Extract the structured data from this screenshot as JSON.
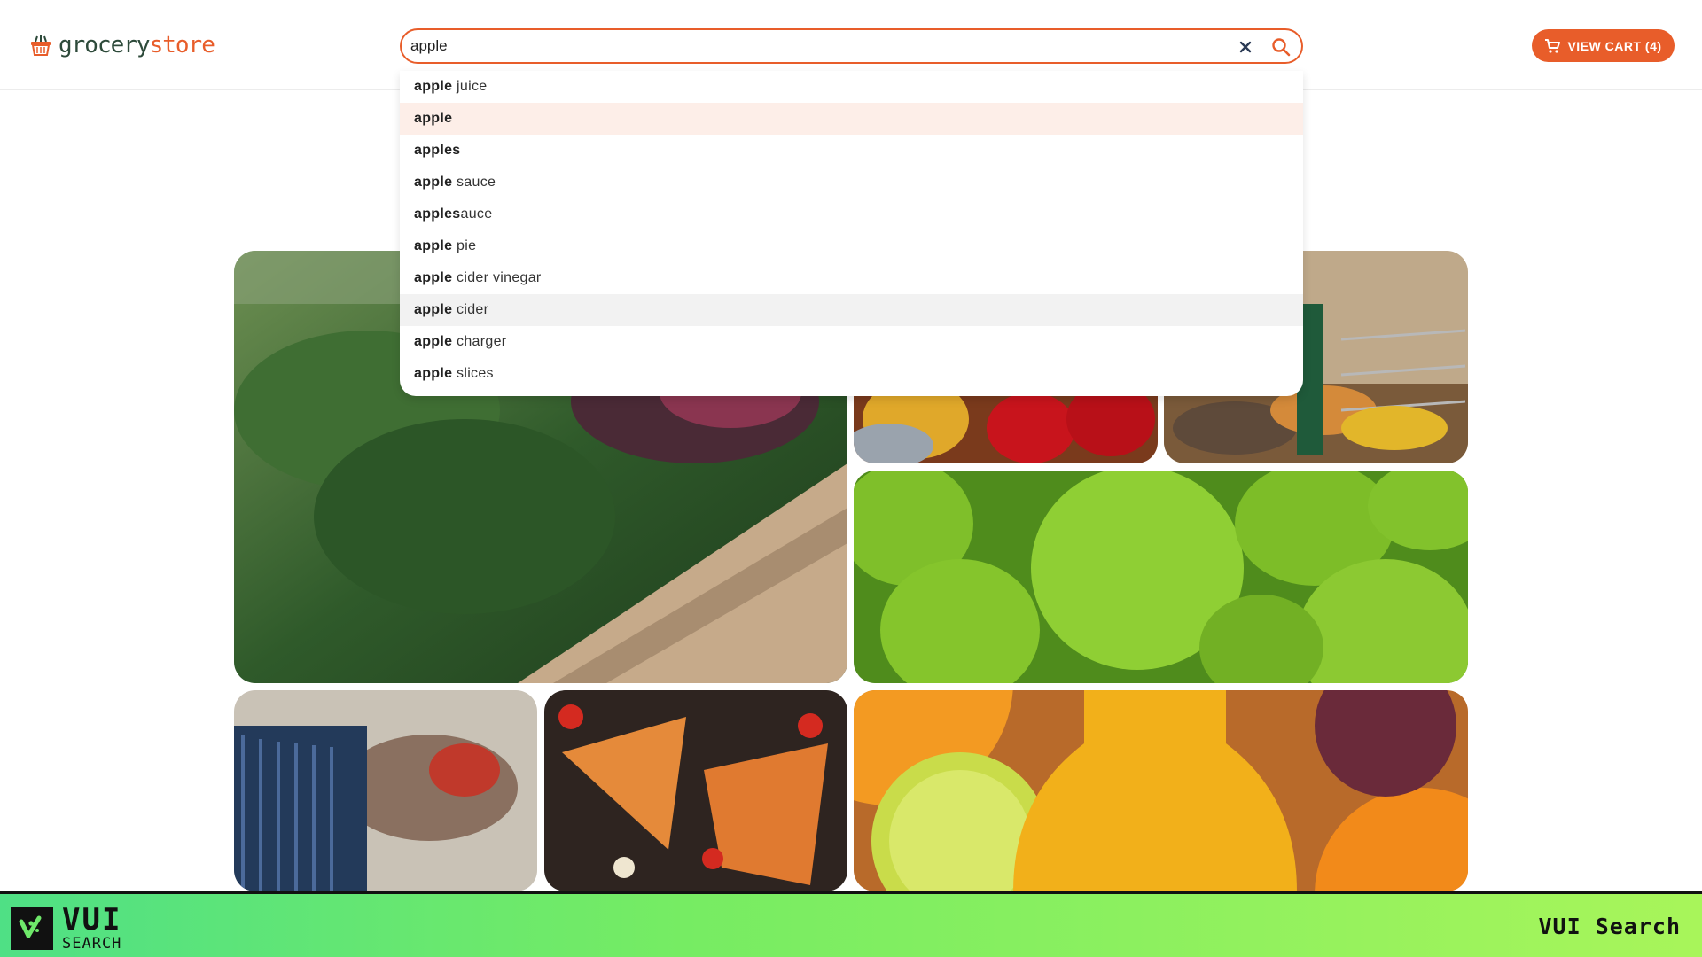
{
  "header": {
    "logo_part1": "grocery",
    "logo_part2": "store",
    "brand_color": "#e85d2a",
    "logo_dark_color": "#2d4a3a"
  },
  "search": {
    "value": "apple",
    "clear_icon": "close-icon",
    "submit_icon": "search-icon"
  },
  "cart": {
    "label": "VIEW CART (4)",
    "icon": "shopping-cart-icon"
  },
  "suggestions": [
    {
      "bold": "apple",
      "rest": " juice",
      "state": ""
    },
    {
      "bold": "apple",
      "rest": "",
      "state": "active"
    },
    {
      "bold": "apples",
      "rest": "",
      "state": ""
    },
    {
      "bold": "apple",
      "rest": " sauce",
      "state": ""
    },
    {
      "bold": "apples",
      "rest": "auce",
      "state": ""
    },
    {
      "bold": "apple",
      "rest": " pie",
      "state": ""
    },
    {
      "bold": "apple",
      "rest": " cider vinegar",
      "state": ""
    },
    {
      "bold": "apple",
      "rest": " cider",
      "state": "hover"
    },
    {
      "bold": "apple",
      "rest": " charger",
      "state": ""
    },
    {
      "bold": "apple",
      "rest": " slices",
      "state": ""
    }
  ],
  "tiles": [
    {
      "name": "leafy-greens-image",
      "subject": "leafy greens in market basket"
    },
    {
      "name": "bell-peppers-image",
      "subject": "red and yellow bell peppers"
    },
    {
      "name": "shopping-cart-aisle-image",
      "subject": "shopping cart in produce aisle"
    },
    {
      "name": "green-apples-image",
      "subject": "green apples"
    },
    {
      "name": "store-cart-image",
      "subject": "blue shopping cart in store"
    },
    {
      "name": "pizza-image",
      "subject": "pizza slices"
    },
    {
      "name": "orange-juice-image",
      "subject": "orange juice with citrus"
    }
  ],
  "footer": {
    "logo_line1": "VUI",
    "logo_line2": "SEARCH",
    "right_label": "VUI Search"
  }
}
